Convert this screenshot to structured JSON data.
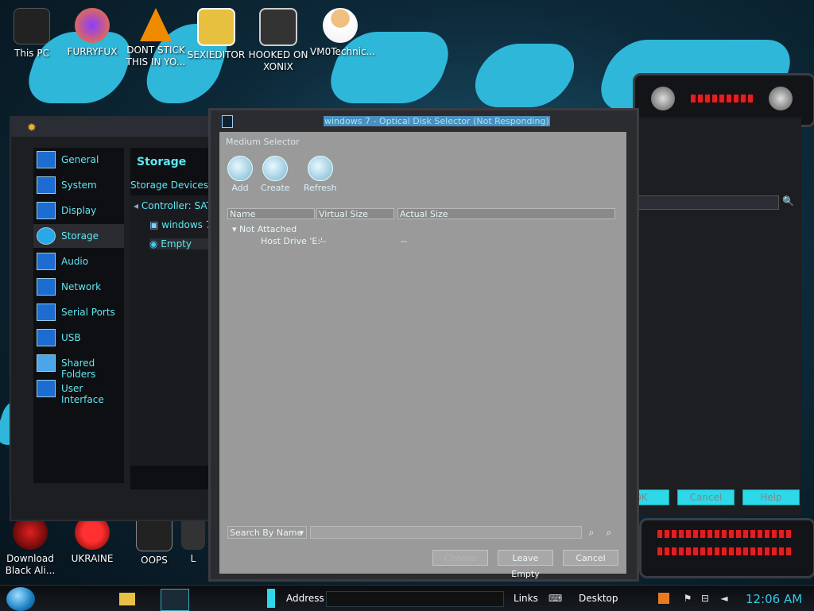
{
  "desktop_icons": [
    {
      "label": "This PC"
    },
    {
      "label": "FURRYFUX"
    },
    {
      "label": "DONT STICK THIS IN YO..."
    },
    {
      "label": "SEXIEDITOR"
    },
    {
      "label": "HOOKED ON XONIX"
    },
    {
      "label": "VM0Technic..."
    },
    {
      "label": "Download Black Ali..."
    },
    {
      "label": "UKRAINE"
    },
    {
      "label": "OOPS"
    },
    {
      "label": "L"
    }
  ],
  "settings_window": {
    "nav_items": [
      {
        "label": "General"
      },
      {
        "label": "System"
      },
      {
        "label": "Display"
      },
      {
        "label": "Storage"
      },
      {
        "label": "Audio"
      },
      {
        "label": "Network"
      },
      {
        "label": "Serial Ports"
      },
      {
        "label": "USB"
      },
      {
        "label": "Shared Folders"
      },
      {
        "label": "User Interface"
      }
    ],
    "page_title": "Storage",
    "storage_devices_label": "Storage Devices",
    "tree": {
      "controller": "Controller: SAT",
      "disk": "windows 7",
      "optical": "Empty"
    },
    "buttons": {
      "ok": "OK",
      "cancel": "Cancel",
      "help": "Help"
    }
  },
  "dialog": {
    "title": "windows 7 - Optical Disk Selector (Not Responding)",
    "section_label": "Medium Selector",
    "toolbar": {
      "add": "Add",
      "create": "Create",
      "refresh": "Refresh"
    },
    "columns": {
      "name": "Name",
      "virtual_size": "Virtual Size",
      "actual_size": "Actual Size"
    },
    "rows": {
      "group": "Not Attached",
      "item_name": "Host Drive 'E:'",
      "item_virtual": "--",
      "item_actual": "--"
    },
    "search_mode": "Search By Name",
    "search_value": "",
    "buttons": {
      "choose": "Choose",
      "leave_empty": "Leave Empty",
      "cancel": "Cancel"
    }
  },
  "taskbar": {
    "address_label": "Address",
    "links_label": "Links",
    "desktop_label": "Desktop",
    "clock": "12:06 AM"
  },
  "colors": {
    "accent_cyan": "#2fd8e8",
    "alien_red": "#e02020",
    "dialog_gray": "#9a9a9a"
  }
}
